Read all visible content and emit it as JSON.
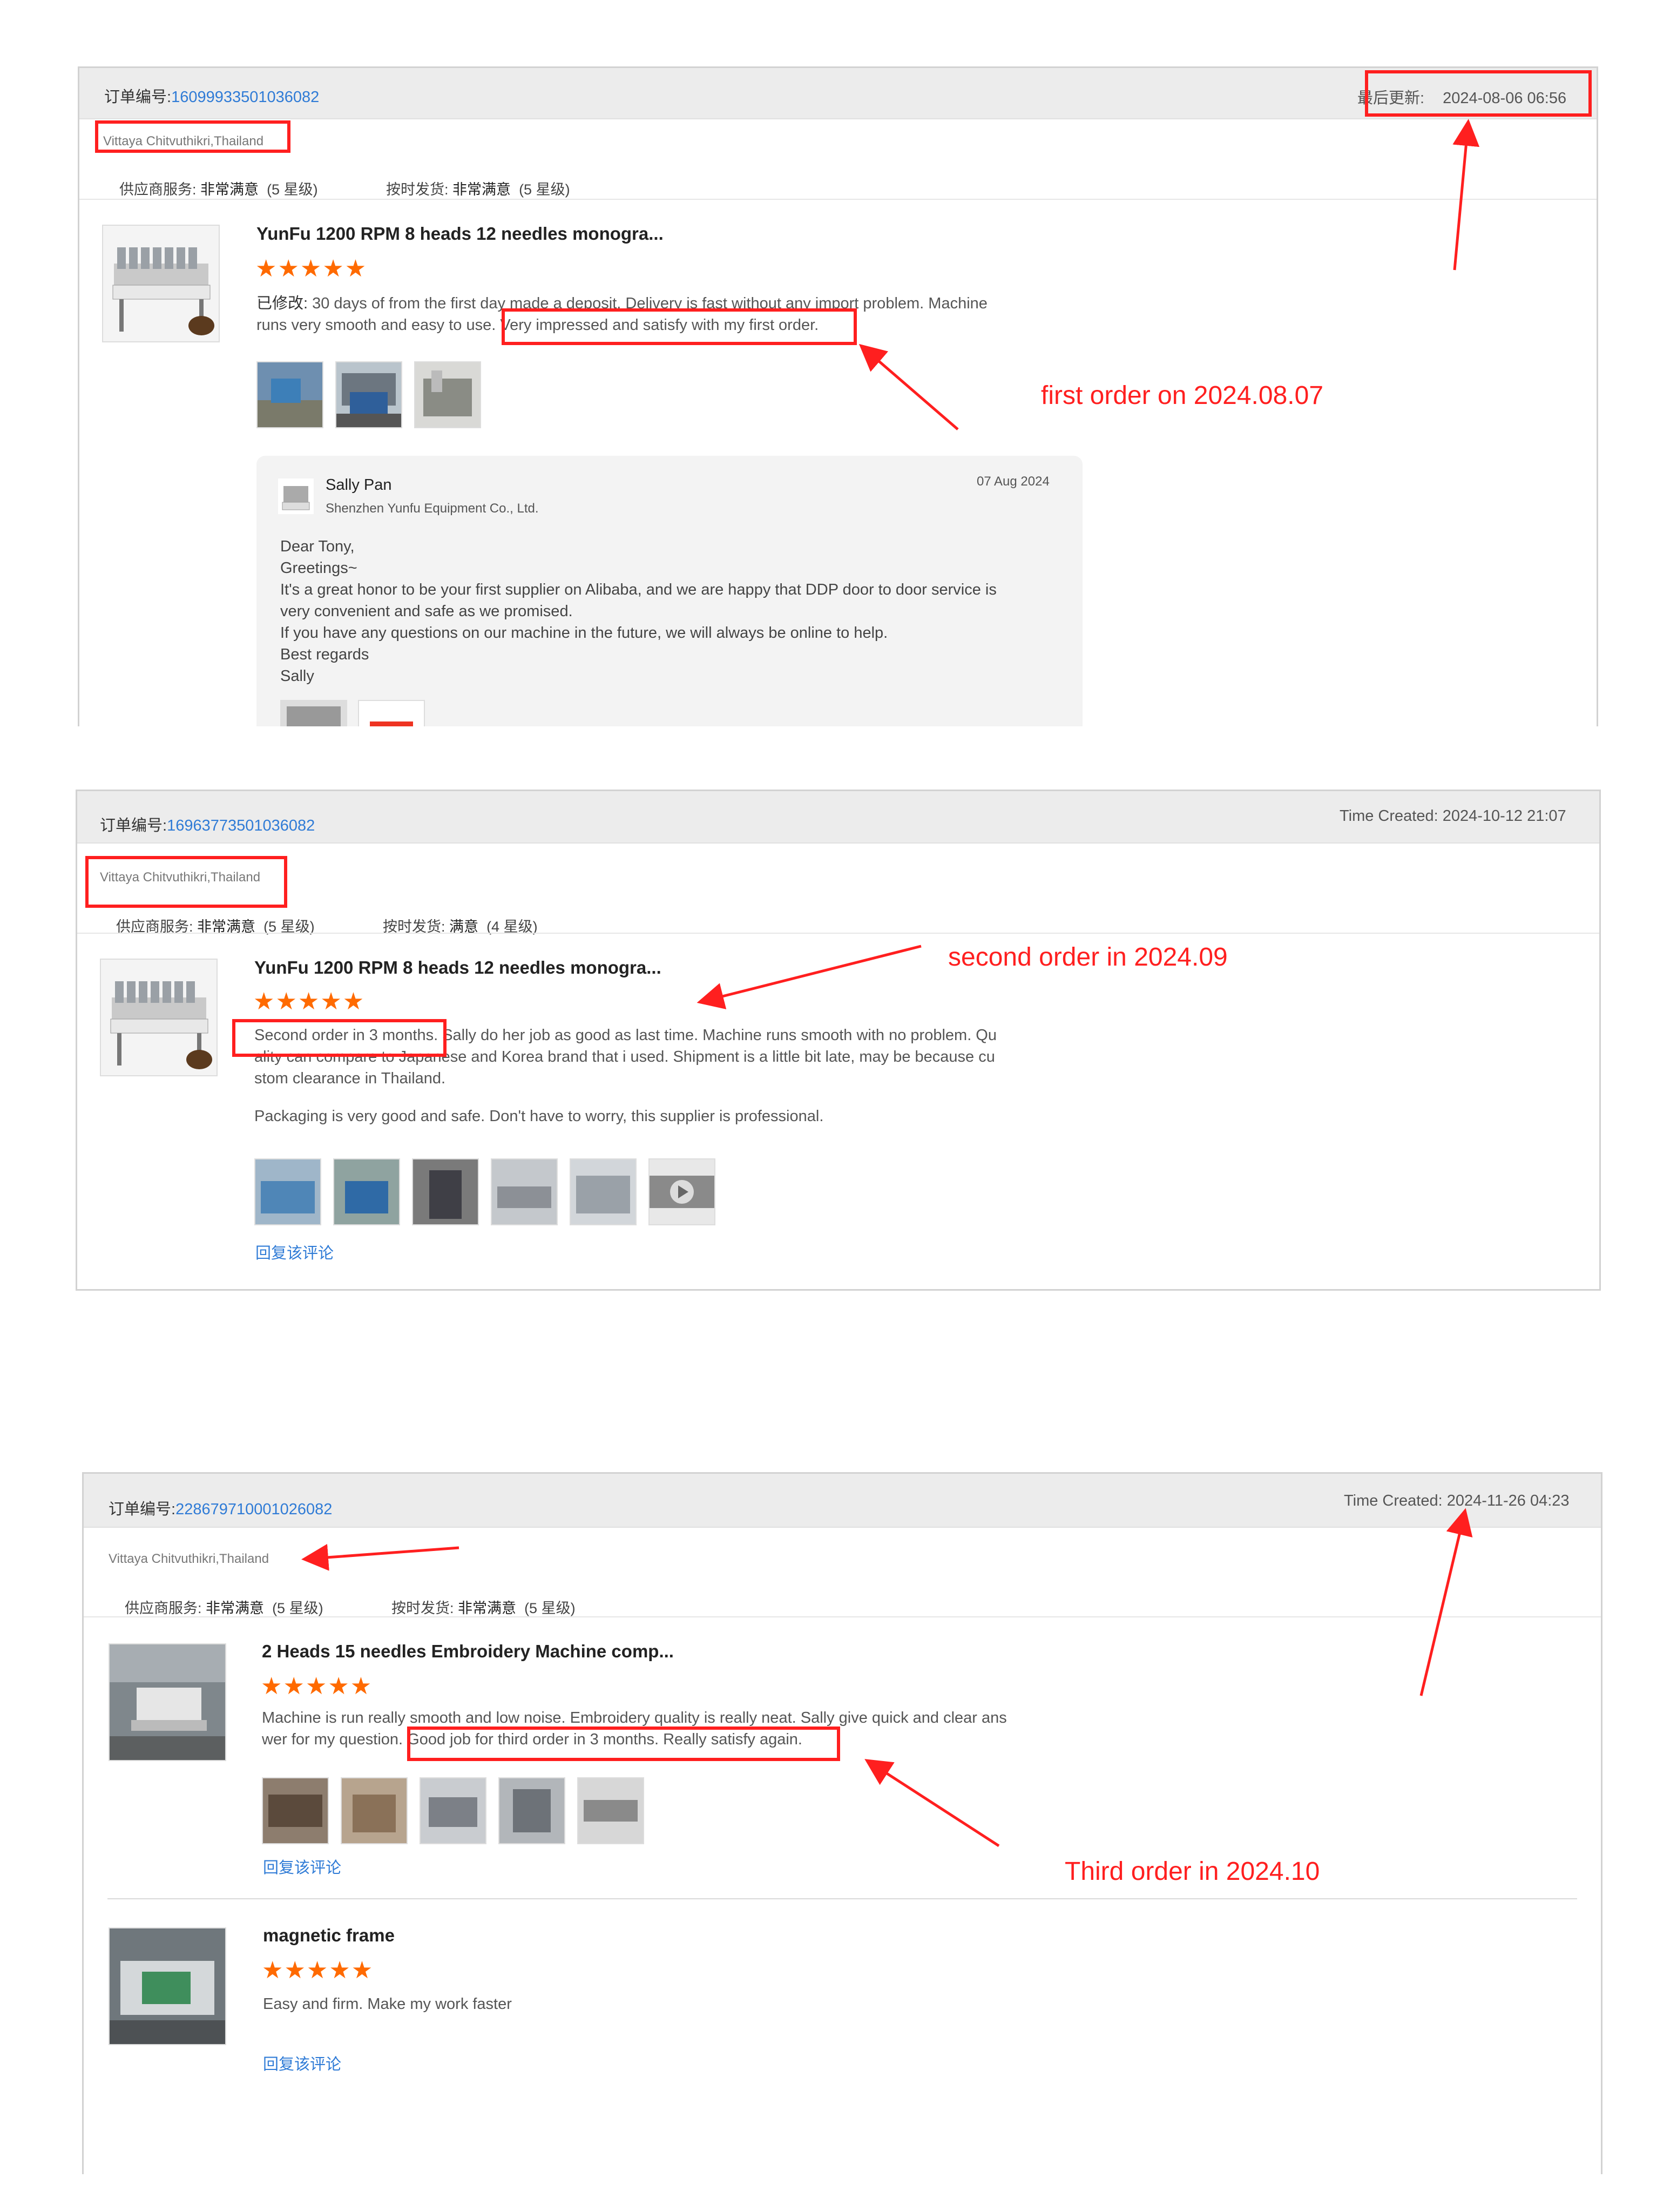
{
  "colors": {
    "accent": "#2f7bd6",
    "star": "#ff6a00",
    "annotation": "#ff1f1f"
  },
  "icons": {
    "rating": "star-icon",
    "play": "play-icon"
  },
  "orders": [
    {
      "order_label": "订单编号:",
      "order_number": "16099933501036082",
      "time_label": "最后更新:",
      "time_value": "2024-08-06 06:56",
      "buyer": "Vittaya Chitvuthikri,Thailand",
      "supplier_label": "供应商服务:",
      "supplier_value": "非常满意",
      "supplier_stars": "(5 星级)",
      "delivery_label": "按时发货:",
      "delivery_value": "非常满意",
      "delivery_stars": "(5 星级)",
      "product_title": "YunFu 1200 RPM 8 heads 12 needles monogra...",
      "rating": 5,
      "stars": "★★★★★",
      "review_prefix": "已修改:",
      "review_line1": " 30 days of from the first day made a deposit. Delivery is fast without any import problem. Machine",
      "review_line2": "runs very smooth and easy to use. Very impressed and satisfy with my first order.",
      "reply": {
        "author": "Sally Pan",
        "company": "Shenzhen Yunfu Equipment Co., Ltd.",
        "date": "07 Aug 2024",
        "lines": [
          "Dear Tony,",
          "Greetings~",
          "It's a great honor to be your first supplier on Alibaba, and we are happy that DDP door to door service is",
          "very convenient and safe as we promised.",
          "If you have any questions on our machine in the future, we will always be online to help.",
          "Best regards",
          "Sally"
        ]
      },
      "annotation": "first order on 2024.08.07"
    },
    {
      "order_label": "订单编号:",
      "order_number": "16963773501036082",
      "time_label": "Time Created:",
      "time_value": "2024-10-12 21:07",
      "buyer": "Vittaya Chitvuthikri,Thailand",
      "supplier_label": "供应商服务:",
      "supplier_value": "非常满意",
      "supplier_stars": "(5 星级)",
      "delivery_label": "按时发货:",
      "delivery_value": "满意",
      "delivery_stars": "(4 星级)",
      "product_title": "YunFu 1200 RPM 8 heads 12 needles monogra...",
      "rating": 5,
      "stars": "★★★★★",
      "review_line1": "Second order in 3 months. Sally do her job as good as last time. Machine runs smooth with no problem. Qu",
      "review_line2": "ality can compare to Japanese and Korea brand that i used. Shipment is a little bit late, may be because cu",
      "review_line3": "stom clearance  in Thailand.",
      "review_line4": "Packaging is very good and safe. Don't have to worry, this supplier is professional.",
      "reply_link": "回复该评论",
      "annotation": "second order in 2024.09"
    },
    {
      "order_label": "订单编号:",
      "order_number": "228679710001026082",
      "time_label": "Time Created:",
      "time_value": "2024-11-26 04:23",
      "buyer": "Vittaya Chitvuthikri,Thailand",
      "supplier_label": "供应商服务:",
      "supplier_value": "非常满意",
      "supplier_stars": "(5 星级)",
      "delivery_label": "按时发货:",
      "delivery_value": "非常满意",
      "delivery_stars": "(5 星级)",
      "product_title": "2 Heads 15 needles Embroidery Machine comp...",
      "rating": 5,
      "stars": "★★★★★",
      "review_line1": "Machine is run really smooth and low noise. Embroidery quality is really neat. Sally give quick and clear ans",
      "review_line2": "wer for my question. Good job for third order in 3 months. Really satisfy again.",
      "reply_link": "回复该评论",
      "annotation": "Third order in 2024.10",
      "product2_title": "magnetic frame",
      "product2_rating": 5,
      "product2_stars": "★★★★★",
      "product2_review": "Easy and firm. Make my work faster",
      "product2_reply_link": "回复该评论"
    }
  ]
}
